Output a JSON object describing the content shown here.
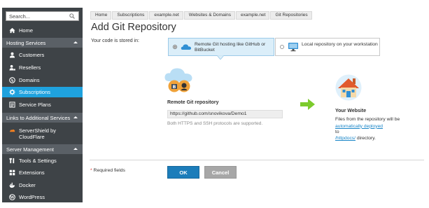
{
  "sidebar": {
    "search_placeholder": "Search...",
    "home": "Home",
    "sections": [
      {
        "title": "Hosting Services",
        "items": [
          "Customers",
          "Resellers",
          "Domains",
          "Subscriptions",
          "Service Plans"
        ]
      },
      {
        "title": "Links to Additional Services",
        "items": [
          "ServerShield by CloudFlare"
        ]
      },
      {
        "title": "Server Management",
        "items": [
          "Tools & Settings",
          "Extensions",
          "Docker",
          "WordPress"
        ]
      }
    ],
    "active_item": "Subscriptions",
    "active_color": "#1fa2de"
  },
  "breadcrumbs": [
    "Home",
    "Subscriptions",
    "example.net",
    "Websites & Domains",
    "example.net",
    "Git Repositories"
  ],
  "page_title": "Add Git Repository",
  "stored_label": "Your code is stored in:",
  "options": {
    "remote": "Remote Git hosting like GitHub or BitBucket",
    "local": "Local repository on your workstation",
    "selected": "remote"
  },
  "remote": {
    "title": "Remote Git repository",
    "value": "https://github.com/snovikova/Demo1",
    "hint": "Both HTTPS and SSH protocols are supported."
  },
  "website": {
    "title": "Your Website",
    "desc_prefix": "Files from the repository will be",
    "desc_link": "automatically deployed",
    "to": "to",
    "dir_link": "/httpdocs/",
    "dir_suffix": " directory."
  },
  "required_note": "Required fields",
  "buttons": {
    "ok": "OK",
    "cancel": "Cancel"
  }
}
